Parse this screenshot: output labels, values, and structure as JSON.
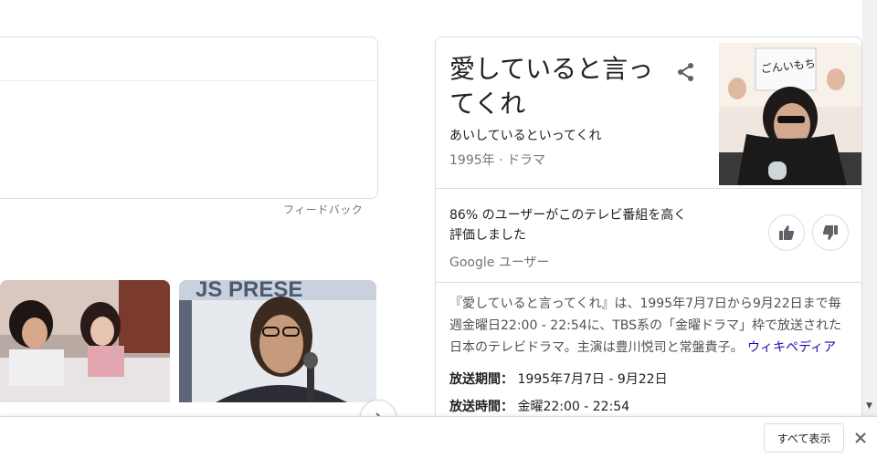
{
  "feedback_label": "フィードバック",
  "knowledge_panel": {
    "title": "愛していると言ってくれ",
    "reading": "あいしているといってくれ",
    "subtitle": "1995年 · ドラマ",
    "rating_text": "86% のユーザーがこのテレビ番組を高く評価しました",
    "rating_source": "Google ユーザー",
    "description": "『愛していると言ってくれ』は、1995年7月7日から9月22日まで毎週金曜日22:00 - 22:54に、TBS系の「金曜ドラマ」枠で放送された日本のテレビドラマ。主演は豊川悦司と常盤貴子。",
    "wiki_link": "ウィキペディア",
    "facts": [
      {
        "label": "放送期間：",
        "value": "1995年7月7日 - 9月22日"
      },
      {
        "label": "放送時間：",
        "value": "金曜22:00 - 22:54"
      }
    ],
    "image_sign_text": "ごんいもち"
  },
  "bottom_bar": {
    "show_all_label": "すべて表示"
  },
  "colors": {
    "link": "#1a0dab",
    "secondary_text": "#70757a",
    "border": "#dadce0"
  },
  "icons": [
    "share-icon",
    "thumbs-up-icon",
    "thumbs-down-icon",
    "chevron-right-icon",
    "close-icon"
  ]
}
